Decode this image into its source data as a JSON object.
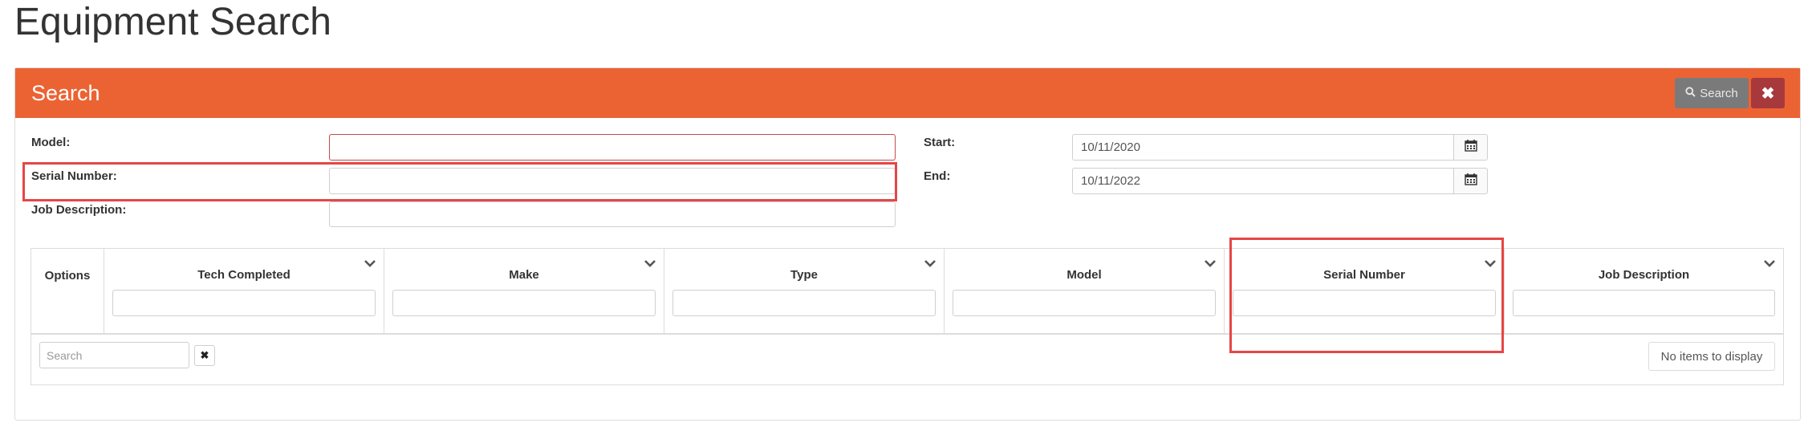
{
  "page": {
    "title": "Equipment Search"
  },
  "panel": {
    "title": "Search",
    "search_button_label": "Search",
    "clear_button_icon": "close-icon"
  },
  "form": {
    "model_label": "Model:",
    "serial_label": "Serial Number:",
    "job_label": "Job Description:",
    "start_label": "Start:",
    "end_label": "End:",
    "start_value": "10/11/2020",
    "end_value": "10/11/2022"
  },
  "grid": {
    "options_label": "Options",
    "columns": [
      {
        "title": "Tech Completed"
      },
      {
        "title": "Make"
      },
      {
        "title": "Type"
      },
      {
        "title": "Model"
      },
      {
        "title": "Serial Number"
      },
      {
        "title": "Job Description"
      }
    ],
    "search_placeholder": "Search",
    "empty_text": "No items to display"
  },
  "colors": {
    "accent": "#ec6333",
    "danger": "#a7393d",
    "highlight": "#e64646"
  }
}
